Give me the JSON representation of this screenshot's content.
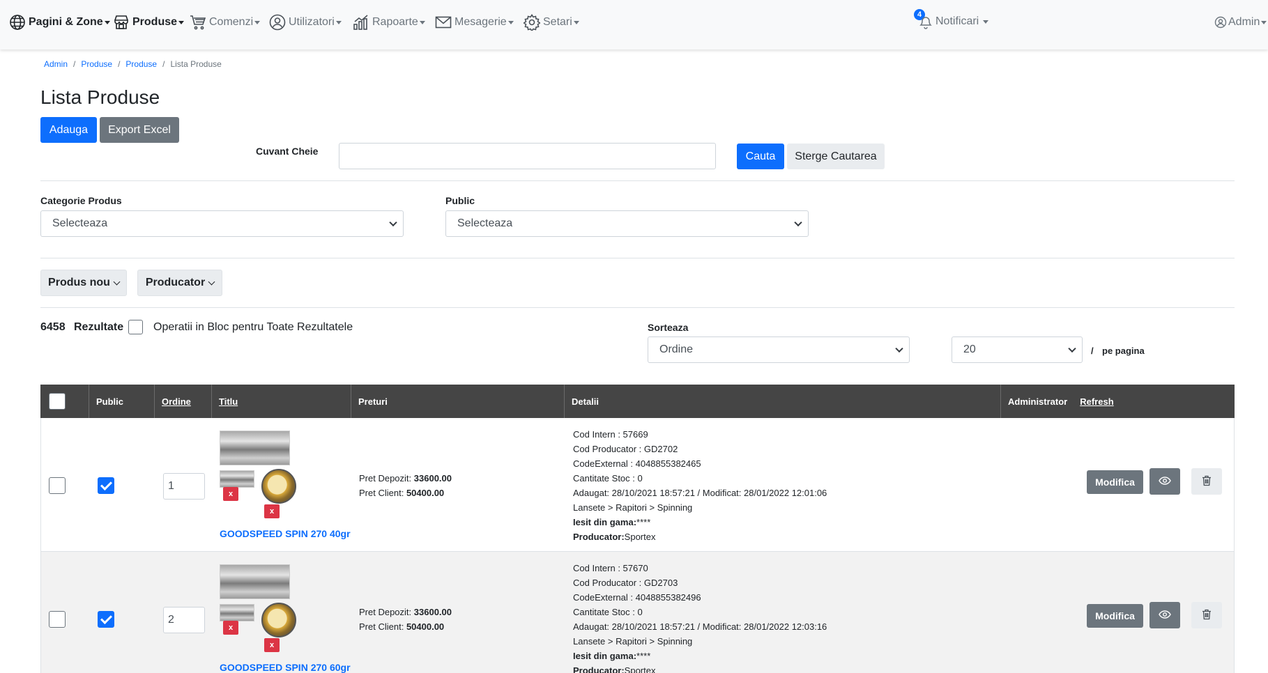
{
  "nav": {
    "items": [
      {
        "label": "Pagini & Zone",
        "icon": "globe-icon"
      },
      {
        "label": "Produse",
        "icon": "store-icon"
      },
      {
        "label": "Comenzi",
        "icon": "cart-icon"
      },
      {
        "label": "Utilizatori",
        "icon": "user-circle-icon"
      },
      {
        "label": "Rapoarte",
        "icon": "chart-icon"
      },
      {
        "label": "Mesagerie",
        "icon": "envelope-icon"
      },
      {
        "label": "Setari",
        "icon": "gear-icon"
      }
    ],
    "notifications_label": "Notificari",
    "notifications_count": "4",
    "admin_label": "Admin"
  },
  "breadcrumb": [
    "Admin",
    "Produse",
    "Produse",
    "Lista Produse"
  ],
  "page_title": "Lista Produse",
  "buttons": {
    "add": "Adauga",
    "export": "Export Excel",
    "search": "Cauta",
    "clear_search": "Sterge Cautarea"
  },
  "search": {
    "label": "Cuvant Cheie",
    "value": ""
  },
  "filters": {
    "category_label": "Categorie Produs",
    "category_value": "Selecteaza",
    "public_label": "Public",
    "public_value": "Selecteaza",
    "new_product": "Produs nou",
    "producer": "Producator"
  },
  "results": {
    "count": "6458",
    "label": "Rezultate",
    "bulk_label": "Operatii in Bloc pentru Toate Rezultatele",
    "sort_label": "Sorteaza",
    "sort_value": "Ordine",
    "per_page_value": "20",
    "per_page_sep": "/",
    "per_page_label": "pe pagina"
  },
  "table": {
    "headers": {
      "public": "Public",
      "order": "Ordine",
      "title": "Titlu",
      "prices": "Preturi",
      "details": "Detalii",
      "admin": "Administrator",
      "refresh": "Refresh"
    },
    "rows": [
      {
        "selected": false,
        "public": true,
        "order": "1",
        "title": "GOODSPEED SPIN 270 40gr",
        "del": "x",
        "price_depot_label": "Pret Depozit:",
        "price_depot": "33600.00",
        "price_client_label": "Pret Client:",
        "price_client": "50400.00",
        "cod_intern": "Cod Intern : 57669",
        "cod_producator": "Cod Producator : GD2702",
        "code_external": "CodeExternal : 4048855382465",
        "stoc": "Cantitate Stoc : 0",
        "dates": "Adaugat: 28/10/2021 18:57:21 / Modificat: 28/01/2022 12:01:06",
        "category": "Lansete > Rapitori > Spinning",
        "out_label": "Iesit din gama:",
        "out_value": "****",
        "producer_label": "Producator:",
        "producer_value": "Sportex",
        "edit": "Modifica"
      },
      {
        "selected": false,
        "public": true,
        "order": "2",
        "title": "GOODSPEED SPIN 270 60gr",
        "del": "x",
        "price_depot_label": "Pret Depozit:",
        "price_depot": "33600.00",
        "price_client_label": "Pret Client:",
        "price_client": "50400.00",
        "cod_intern": "Cod Intern : 57670",
        "cod_producator": "Cod Producator : GD2703",
        "code_external": "CodeExternal : 4048855382496",
        "stoc": "Cantitate Stoc : 0",
        "dates": "Adaugat: 28/10/2021 18:57:21 / Modificat: 28/01/2022 12:03:16",
        "category": "Lansete > Rapitori > Spinning",
        "out_label": "Iesit din gama:",
        "out_value": "****",
        "producer_label": "Producator:",
        "producer_value": "Sportex",
        "edit": "Modifica"
      }
    ]
  },
  "colors": {
    "primary": "#0d6efd",
    "secondary": "#6c757d",
    "danger": "#dc3545",
    "table_header": "#454545"
  }
}
